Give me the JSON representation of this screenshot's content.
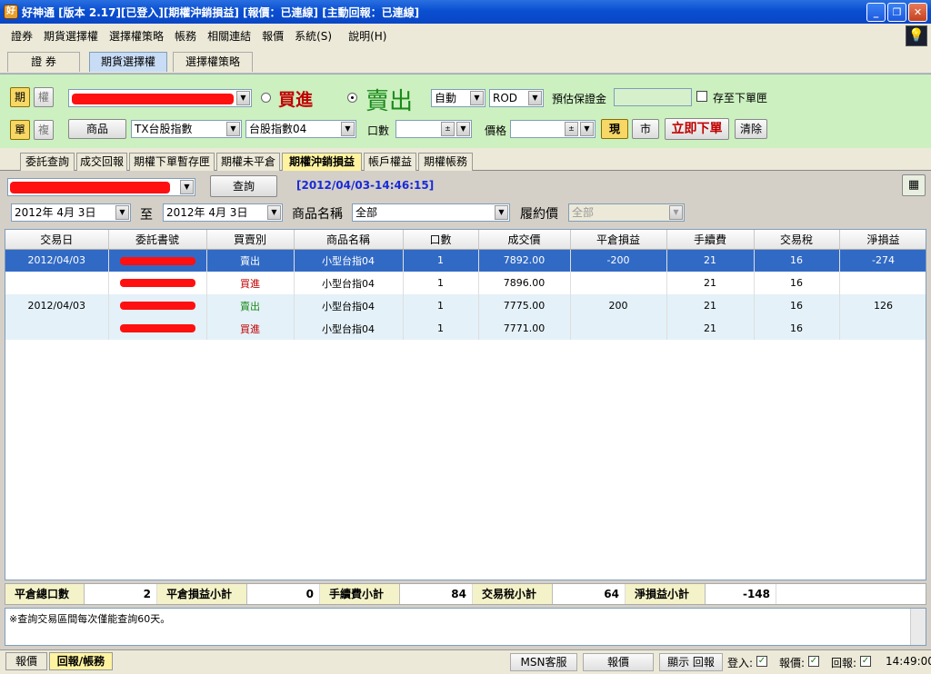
{
  "window": {
    "title": "好神通 [版本 2.17][已登入][期權沖銷損益] [報價：已連線] [主動回報：已連線]"
  },
  "menu": [
    "證券",
    "期貨選擇權",
    "選擇權策略",
    "帳務",
    "相關連結",
    "報價",
    "系統(S)",
    "說明(H)"
  ],
  "top_tabs": [
    "證 券",
    "期貨選擇權",
    "選擇權策略"
  ],
  "order": {
    "type_qi": "期",
    "type_quan": "權",
    "mode_dan": "單",
    "mode_fu": "複",
    "buy_label": "買進",
    "sell_label": "賣出",
    "auto": "自動",
    "rod": "ROD",
    "margin_label": "預估保證金",
    "save_label": "存至下單匣",
    "product_btn": "商品",
    "product": "TX台股指數",
    "contract": "台股指數04",
    "qty_label": "口數",
    "price_label": "價格",
    "cur_btn": "現",
    "market_btn": "市",
    "submit_btn": "立即下單",
    "clear_btn": "清除"
  },
  "sub_tabs": [
    "委託查詢",
    "成交回報",
    "期權下單暫存匣",
    "期權未平倉",
    "期權沖銷損益",
    "帳戶權益",
    "期權帳務"
  ],
  "query": {
    "query_btn": "查詢",
    "timestamp": "[2012/04/03-14:46:15]",
    "date_from": "2012年 4月 3日",
    "to_label": "至",
    "date_to": "2012年 4月 3日",
    "product_label": "商品名稱",
    "product_value": "全部",
    "strike_label": "履約價",
    "strike_value": "全部"
  },
  "table": {
    "headers": [
      "交易日",
      "委託書號",
      "買賣別",
      "商品名稱",
      "口數",
      "成交價",
      "平倉損益",
      "手續費",
      "交易稅",
      "淨損益"
    ],
    "rows": [
      {
        "date": "2012/04/03",
        "side": "賣出",
        "side_type": "sell",
        "product": "小型台指04",
        "qty": "1",
        "price": "7892.00",
        "pnl": "-200",
        "fee": "21",
        "tax": "16",
        "net": "-274",
        "style": "sel"
      },
      {
        "date": "",
        "side": "買進",
        "side_type": "buy",
        "product": "小型台指04",
        "qty": "1",
        "price": "7896.00",
        "pnl": "",
        "fee": "21",
        "tax": "16",
        "net": "",
        "style": "white"
      },
      {
        "date": "2012/04/03",
        "side": "賣出",
        "side_type": "sell",
        "product": "小型台指04",
        "qty": "1",
        "price": "7775.00",
        "pnl": "200",
        "fee": "21",
        "tax": "16",
        "net": "126",
        "style": "alt"
      },
      {
        "date": "",
        "side": "買進",
        "side_type": "buy",
        "product": "小型台指04",
        "qty": "1",
        "price": "7771.00",
        "pnl": "",
        "fee": "21",
        "tax": "16",
        "net": "",
        "style": "alt"
      }
    ]
  },
  "summary": {
    "total_qty_label": "平倉總口數",
    "total_qty": "2",
    "pnl_label": "平倉損益小計",
    "pnl": "0",
    "fee_label": "手續費小計",
    "fee": "84",
    "tax_label": "交易稅小計",
    "tax": "64",
    "net_label": "淨損益小計",
    "net": "-148"
  },
  "note": "※查詢交易區間每次僅能查詢60天。",
  "status": {
    "tab_quote": "報價",
    "tab_report": "回報/帳務",
    "msn": "MSN客服",
    "quote_btn": "報價",
    "show_report": "顯示 回報",
    "login_label": "登入:",
    "quote_label": "報價:",
    "report_label": "回報:",
    "time": "14:49:00"
  }
}
